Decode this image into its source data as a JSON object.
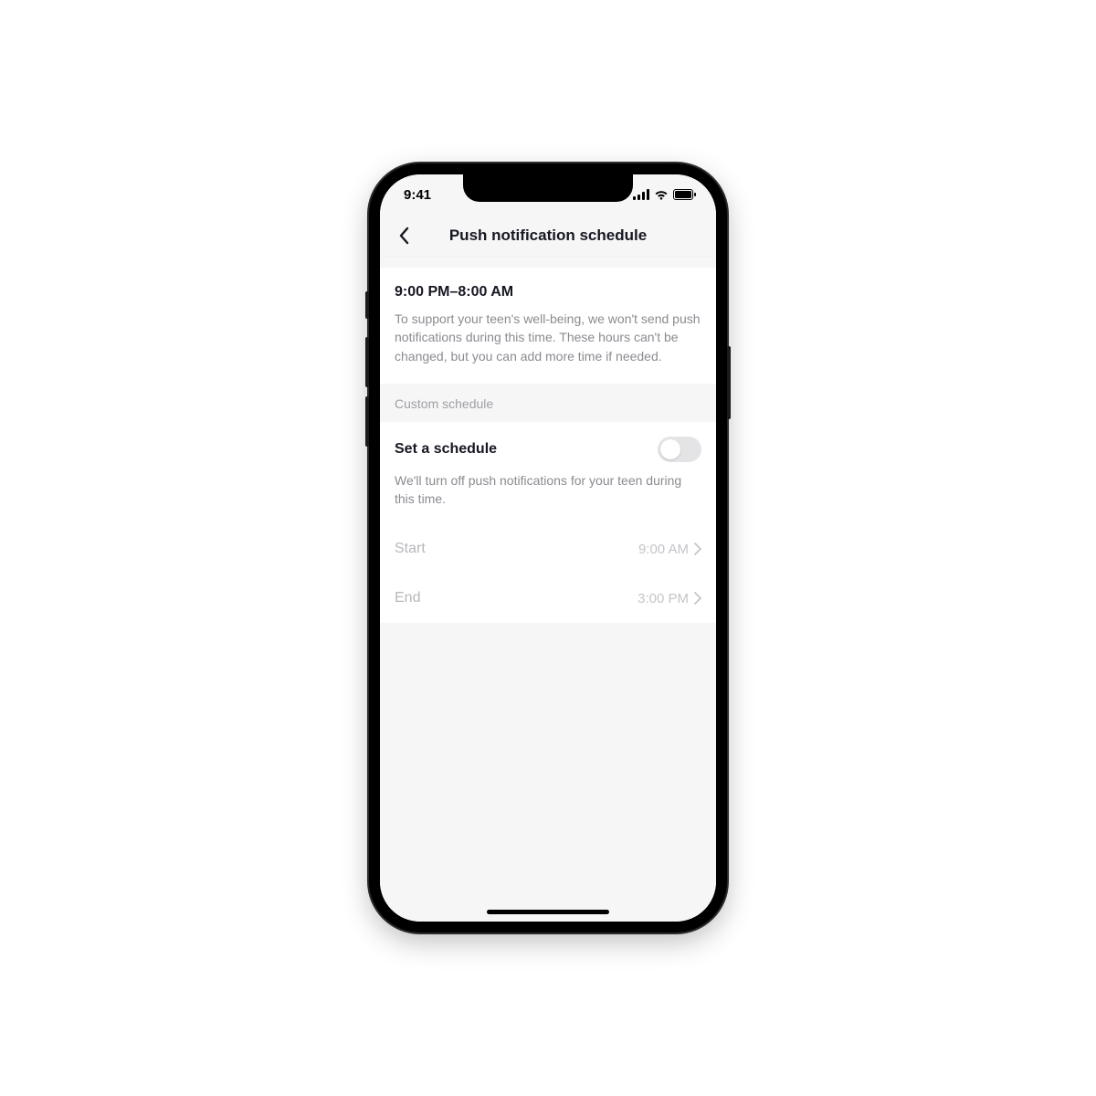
{
  "status": {
    "time": "9:41"
  },
  "header": {
    "title": "Push notification schedule"
  },
  "default_schedule": {
    "range": "9:00 PM–8:00 AM",
    "description": "To support your teen's well-being, we won't send push notifications during this time. These hours can't be changed, but you can add more time if needed."
  },
  "custom": {
    "section_label": "Custom schedule",
    "toggle_title": "Set a schedule",
    "toggle_desc": "We'll turn off push notifications for your teen during this time.",
    "toggle_on": false,
    "rows": {
      "start": {
        "label": "Start",
        "value": "9:00 AM"
      },
      "end": {
        "label": "End",
        "value": "3:00 PM"
      }
    }
  }
}
